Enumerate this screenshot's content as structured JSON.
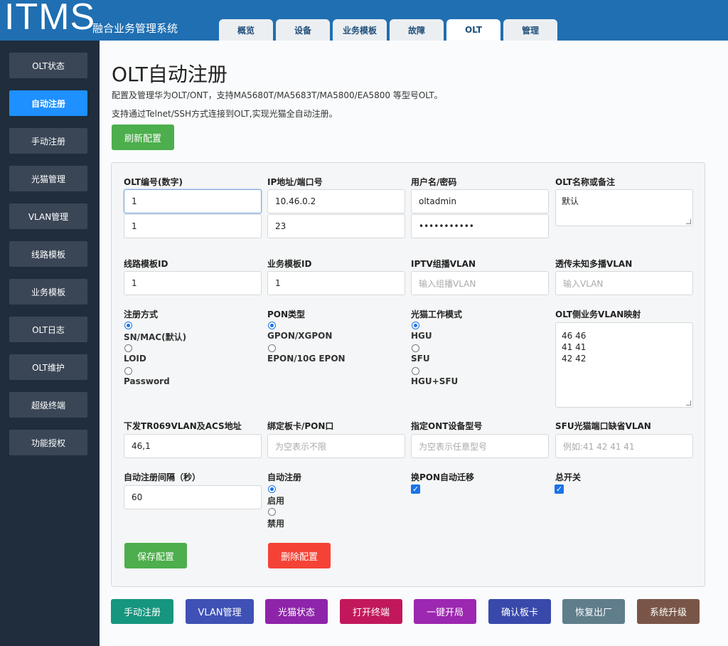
{
  "header": {
    "logo": "ITMS",
    "subtitle": "融合业务管理系统",
    "tabs": [
      "概览",
      "设备",
      "业务模板",
      "故障",
      "OLT",
      "管理"
    ],
    "active_tab": "OLT"
  },
  "sidebar": {
    "items": [
      "OLT状态",
      "自动注册",
      "手动注册",
      "光猫管理",
      "VLAN管理",
      "线路模板",
      "业务模板",
      "OLT日志",
      "OLT维护",
      "超级终端",
      "功能授权"
    ],
    "active": "自动注册"
  },
  "page": {
    "title": "OLT自动注册",
    "desc1": "配置及管理华为OLT/ONT，支持MA5680T/MA5683T/MA5800/EA5800 等型号OLT。",
    "desc2": "支持通过Telnet/SSH方式连接到OLT,实现光猫全自动注册。",
    "refresh_label": "刷新配置"
  },
  "form": {
    "olt_id_label": "OLT编号(数字)",
    "olt_id_value": "1",
    "olt_id_value2": "1",
    "ip_label": "IP地址/端口号",
    "ip_value": "10.46.0.2",
    "port_value": "23",
    "user_label": "用户名/密码",
    "user_value": "oltadmin",
    "password_value": "•••••••••••",
    "name_label": "OLT名称或备注",
    "name_value": "默认",
    "line_tpl_label": "线路模板ID",
    "line_tpl_value": "1",
    "srv_tpl_label": "业务模板ID",
    "srv_tpl_value": "1",
    "iptv_label": "IPTV组播VLAN",
    "iptv_placeholder": "输入组播VLAN",
    "transparent_label": "透传未知多播VLAN",
    "transparent_placeholder": "输入VLAN",
    "reg_mode_label": "注册方式",
    "reg_mode_options": [
      "SN/MAC(默认)",
      "LOID",
      "Password"
    ],
    "reg_mode_selected": "SN/MAC(默认)",
    "pon_label": "PON类型",
    "pon_options": [
      "GPON/XGPON",
      "EPON/10G EPON"
    ],
    "pon_selected": "GPON/XGPON",
    "work_mode_label": "光猫工作模式",
    "work_mode_options": [
      "HGU",
      "SFU",
      "HGU+SFU"
    ],
    "work_mode_selected": "HGU",
    "vlan_map_label": "OLT侧业务VLAN映射",
    "vlan_map_value": "46 46\n41 41\n42 42",
    "tr069_label": "下发TR069VLAN及ACS地址",
    "tr069_value": "46,1",
    "bind_label": "绑定板卡/PON口",
    "bind_placeholder": "为空表示不限",
    "ont_model_label": "指定ONT设备型号",
    "ont_model_placeholder": "为空表示任意型号",
    "sfu_vlan_label": "SFU光猫端口缺省VLAN",
    "sfu_vlan_placeholder": "例如:41 42 41 41",
    "interval_label": "自动注册间隔（秒）",
    "interval_value": "60",
    "auto_reg_label": "自动注册",
    "auto_reg_options": [
      "启用",
      "禁用"
    ],
    "auto_reg_selected": "启用",
    "pon_migrate_label": "换PON自动迁移",
    "pon_migrate_checked": true,
    "master_switch_label": "总开关",
    "master_switch_checked": true,
    "save_label": "保存配置",
    "delete_label": "删除配置"
  },
  "actions": [
    {
      "label": "手动注册",
      "color": "#16967e"
    },
    {
      "label": "VLAN管理",
      "color": "#3f51b5"
    },
    {
      "label": "光猫状态",
      "color": "#8e24aa"
    },
    {
      "label": "打开终端",
      "color": "#c2185b"
    },
    {
      "label": "一键开局",
      "color": "#9c27b0"
    },
    {
      "label": "确认板卡",
      "color": "#3949ab"
    },
    {
      "label": "恢复出厂",
      "color": "#607d8b"
    },
    {
      "label": "系统升级",
      "color": "#795548"
    }
  ]
}
